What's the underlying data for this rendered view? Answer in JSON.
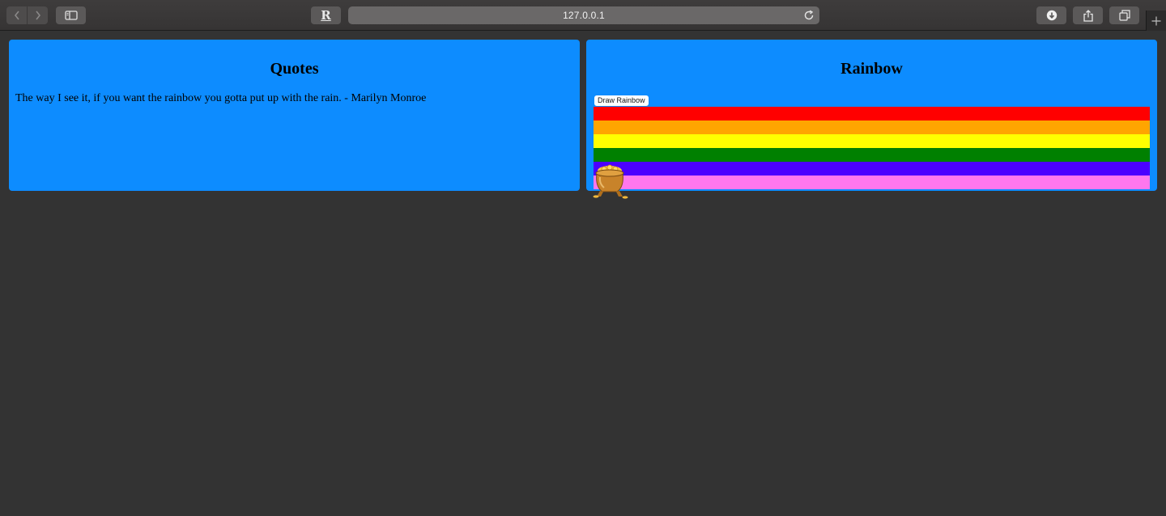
{
  "browser": {
    "url": "127.0.0.1",
    "reader_glyph": "R"
  },
  "quotes_panel": {
    "title": "Quotes",
    "text": "The way I see it, if you want the rainbow you gotta put up with the rain. - Marilyn Monroe"
  },
  "rainbow_panel": {
    "title": "Rainbow",
    "button_label": "Draw Rainbow",
    "bands": [
      "#ff0000",
      "#ffa500",
      "#ffff00",
      "#008000",
      "#4b00ff",
      "#ff77ee"
    ]
  },
  "colors": {
    "panel_bg": "#0d8cff",
    "page_bg": "#333333"
  },
  "icons": {
    "back": "chevron-left-icon",
    "forward": "chevron-right-icon",
    "sidebar": "sidebar-icon",
    "reload": "reload-icon",
    "download": "download-icon",
    "share": "share-icon",
    "tabs": "tabs-icon",
    "new_tab": "plus-icon",
    "pot": "pot-of-gold-icon"
  }
}
